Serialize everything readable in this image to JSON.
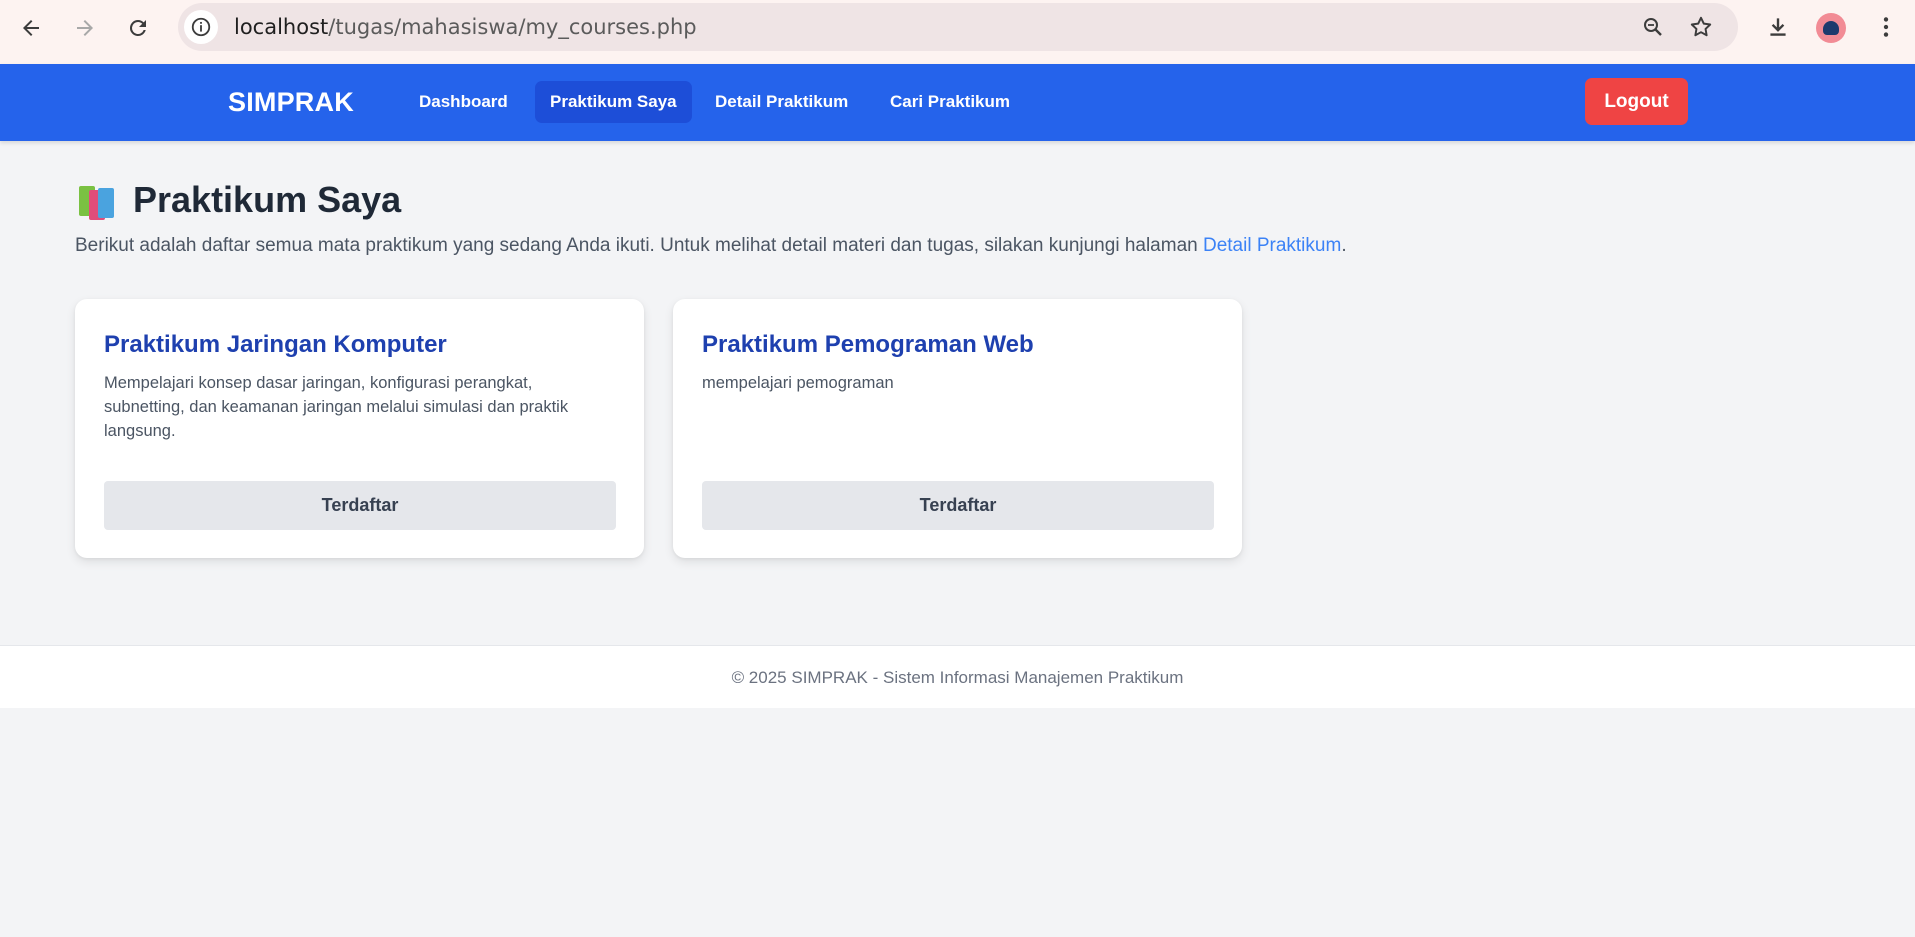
{
  "browser": {
    "url_host": "localhost",
    "url_path": "/tugas/mahasiswa/my_courses.php",
    "icons": [
      "back-icon",
      "forward-icon",
      "reload-icon",
      "site-info-icon",
      "zoom-icon",
      "bookmark-star-icon",
      "download-icon",
      "profile-avatar",
      "menu-kebab-icon"
    ]
  },
  "navbar": {
    "brand": "SIMPRAK",
    "items": [
      {
        "label": "Dashboard",
        "active": false
      },
      {
        "label": "Praktikum Saya",
        "active": true
      },
      {
        "label": "Detail Praktikum",
        "active": false
      },
      {
        "label": "Cari Praktikum",
        "active": false
      }
    ],
    "logout_label": "Logout",
    "colors": {
      "bar": "#2563eb",
      "active": "#1d4ed8",
      "logout": "#ef4444"
    }
  },
  "main": {
    "title": "Praktikum Saya",
    "title_icon": "books-icon",
    "intro_text": "Berikut adalah daftar semua mata praktikum yang sedang Anda ikuti. Untuk melihat detail materi dan tugas, silakan kunjungi halaman ",
    "intro_link": "Detail Praktikum",
    "intro_end": ".",
    "courses": [
      {
        "title": "Praktikum Jaringan Komputer",
        "description": "Mempelajari konsep dasar jaringan, konfigurasi perangkat, subnetting, dan keamanan jaringan melalui simulasi dan praktik langsung.",
        "status_label": "Terdaftar"
      },
      {
        "title": "Praktikum Pemograman Web",
        "description": "mempelajari pemograman",
        "status_label": "Terdaftar"
      }
    ]
  },
  "footer": {
    "text": "© 2025 SIMPRAK - Sistem Informasi Manajemen Praktikum"
  }
}
